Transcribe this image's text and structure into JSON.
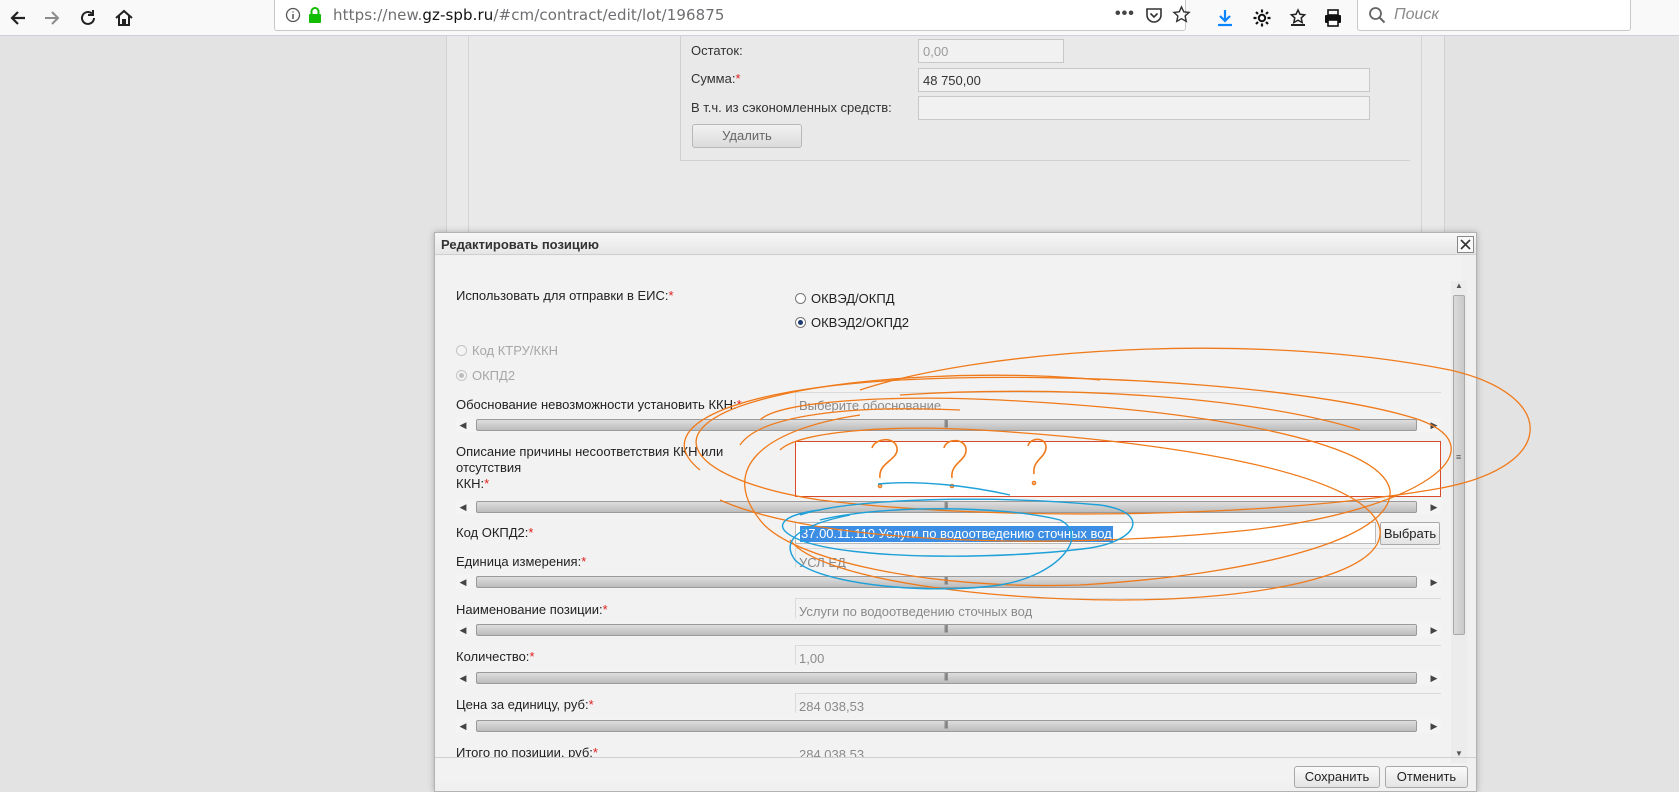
{
  "browser": {
    "url_prefix": "https://new.",
    "url_domain": "gz-spb.ru",
    "url_path": "/#cm/contract/edit/lot/196875",
    "search_placeholder": "Поиск",
    "more_label": "•••"
  },
  "background_form": {
    "remainder_label": "Остаток:",
    "remainder_value": "0,00",
    "sum_label": "Сумма:",
    "sum_value": "48 750,00",
    "savings_label": "В т.ч. из сэкономленных средств:",
    "savings_value": "",
    "delete_button": "Удалить"
  },
  "dialog": {
    "title": "Редактировать позицию",
    "eis_label": "Использовать для отправки в ЕИС:",
    "eis_option_1": "ОКВЭД/ОКПД",
    "eis_option_2": "ОКВЭД2/ОКПД2",
    "ktru_option": "Код КТРУ/ККН",
    "okpd2_option": "ОКПД2",
    "reason_label": "Обоснование невозможности установить ККН:",
    "reason_placeholder": "Выберите обоснование",
    "description_label_1": "Описание причины несоответствия ККН или отсутствия",
    "description_label_2": "ККН:",
    "description_value": "",
    "okpd2_label": "Код ОКПД2:",
    "okpd2_value": "37.00.11.110 Услуги по водоотведению сточных вод",
    "pick_button": "Выбрать",
    "unit_label": "Единица измерения:",
    "unit_value": "УСЛ ЕД",
    "name_label": "Наименование позиции:",
    "name_value": "Услуги по водоотведению сточных вод",
    "qty_label": "Количество:",
    "qty_value": "1,00",
    "price_label": "Цена за единицу, руб:",
    "price_value": "284 038,53",
    "total_label": "Итого по позиции, руб:",
    "total_value": "284 038,53",
    "required_mark": "*",
    "save_button": "Сохранить",
    "cancel_button": "Отменить",
    "eis_selected": "ОКВЭД2/ОКПД2"
  },
  "colors": {
    "accent": "#3b8ee4",
    "required": "#e02020",
    "annotation_orange": "#f07a1a",
    "annotation_blue": "#1ea0d8"
  }
}
